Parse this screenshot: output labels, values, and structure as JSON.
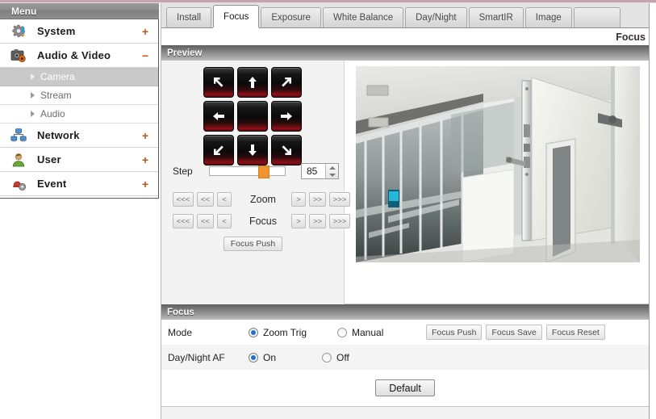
{
  "sidebar": {
    "title": "Menu",
    "items": [
      {
        "label": "System",
        "icon": "gear-icon",
        "expander": "+"
      },
      {
        "label": "Audio & Video",
        "icon": "camera-icon",
        "expander": "−"
      },
      {
        "label": "Network",
        "icon": "network-icon",
        "expander": "+"
      },
      {
        "label": "User",
        "icon": "user-icon",
        "expander": "+"
      },
      {
        "label": "Event",
        "icon": "event-icon",
        "expander": "+"
      }
    ],
    "submenu": [
      {
        "label": "Camera",
        "selected": true
      },
      {
        "label": "Stream",
        "selected": false
      },
      {
        "label": "Audio",
        "selected": false
      }
    ]
  },
  "tabs": [
    {
      "label": "Install",
      "active": false
    },
    {
      "label": "Focus",
      "active": true
    },
    {
      "label": "Exposure",
      "active": false
    },
    {
      "label": "White Balance",
      "active": false
    },
    {
      "label": "Day/Night",
      "active": false
    },
    {
      "label": "SmartIR",
      "active": false
    },
    {
      "label": "Image",
      "active": false
    }
  ],
  "breadcrumb": "Focus",
  "preview": {
    "section_title": "Preview",
    "dpad": [
      "arrow-up-left-icon",
      "arrow-up-icon",
      "arrow-up-right-icon",
      "arrow-left-icon",
      "home-blank-icon",
      "arrow-right-icon",
      "arrow-down-left-icon",
      "arrow-down-icon",
      "arrow-down-right-icon"
    ],
    "step": {
      "label": "Step",
      "value": "85",
      "slider_percent": 65
    },
    "zoom_row": {
      "label": "Zoom",
      "left": [
        "<<<",
        "<<",
        "<"
      ],
      "right": [
        ">",
        ">>",
        ">>>"
      ]
    },
    "focus_row": {
      "label": "Focus",
      "left": [
        "<<<",
        "<<",
        "<"
      ],
      "right": [
        ">",
        ">>",
        ">>>"
      ]
    },
    "focus_push_label": "Focus Push"
  },
  "focus_section": {
    "section_title": "Focus",
    "mode": {
      "label": "Mode",
      "options": [
        {
          "label": "Zoom Trig",
          "selected": true
        },
        {
          "label": "Manual",
          "selected": false
        }
      ],
      "buttons": [
        "Focus Push",
        "Focus Save",
        "Focus Reset"
      ]
    },
    "day_night_af": {
      "label": "Day/Night AF",
      "options": [
        {
          "label": "On",
          "selected": true
        },
        {
          "label": "Off",
          "selected": false
        }
      ]
    },
    "default_label": "Default"
  },
  "colors": {
    "accent_orange": "#c4560f",
    "slider_thumb": "#f0942f",
    "radio_dot": "#1b74d0",
    "selected_submenu_bg": "#c9c9c9",
    "top_rule": "#c3a5ad"
  }
}
